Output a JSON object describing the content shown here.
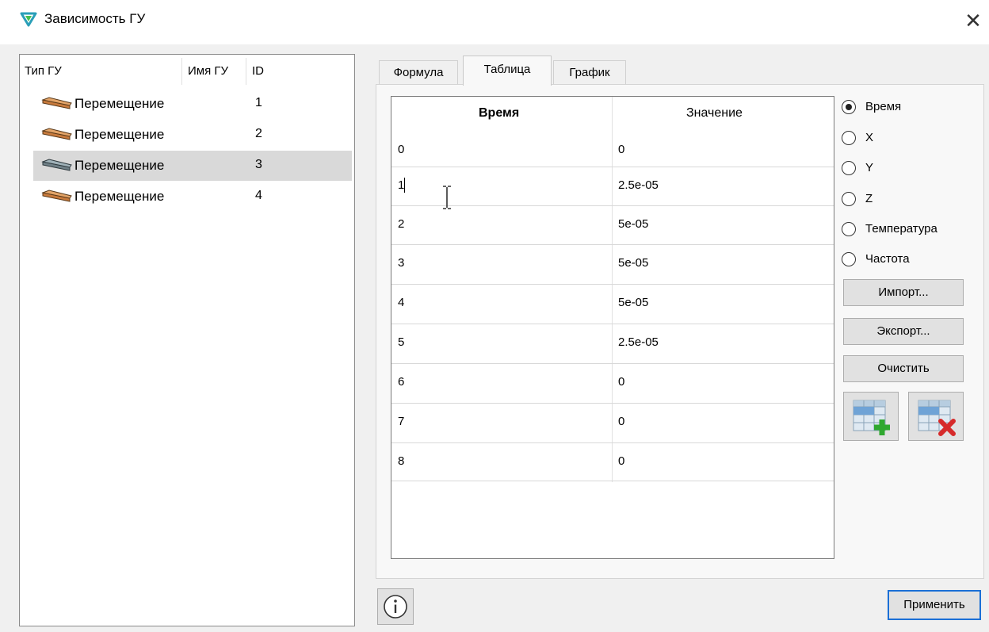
{
  "window": {
    "title": "Зависимость ГУ",
    "close_glyph": "✕"
  },
  "bc_list": {
    "headers": {
      "type": "Тип ГУ",
      "name": "Имя ГУ",
      "id": "ID"
    },
    "rows": [
      {
        "type": "Перемещение",
        "name": "",
        "id": "1",
        "selected": false,
        "icon": "displacement-icon"
      },
      {
        "type": "Перемещение",
        "name": "",
        "id": "2",
        "selected": false,
        "icon": "displacement-icon"
      },
      {
        "type": "Перемещение",
        "name": "",
        "id": "3",
        "selected": true,
        "icon": "displacement-icon"
      },
      {
        "type": "Перемещение",
        "name": "",
        "id": "4",
        "selected": false,
        "icon": "displacement-icon"
      }
    ]
  },
  "tabs": [
    {
      "label": "Формула",
      "active": false
    },
    {
      "label": "Таблица",
      "active": true
    },
    {
      "label": "График",
      "active": false
    }
  ],
  "table": {
    "headers": {
      "time": "Время",
      "value": "Значение"
    },
    "rows": [
      {
        "time": "0",
        "value": "0"
      },
      {
        "time": "1",
        "value": "2.5e-05"
      },
      {
        "time": "2",
        "value": "5e-05"
      },
      {
        "time": "3",
        "value": "5e-05"
      },
      {
        "time": "4",
        "value": "5e-05"
      },
      {
        "time": "5",
        "value": "2.5e-05"
      },
      {
        "time": "6",
        "value": "0"
      },
      {
        "time": "7",
        "value": "0"
      },
      {
        "time": "8",
        "value": "0"
      }
    ],
    "editing_row": 1
  },
  "variable_options": [
    {
      "label": "Время",
      "checked": true
    },
    {
      "label": "X",
      "checked": false
    },
    {
      "label": "Y",
      "checked": false
    },
    {
      "label": "Z",
      "checked": false
    },
    {
      "label": "Температура",
      "checked": false
    },
    {
      "label": "Частота",
      "checked": false
    }
  ],
  "buttons": {
    "import": "Импорт...",
    "export": "Экспорт...",
    "clear": "Очистить",
    "add_row_icon": "add-row-icon",
    "delete_row_icon": "delete-row-icon",
    "info_icon": "info-icon",
    "apply": "Применить"
  },
  "colors": {
    "selection": "#d9d9d9",
    "accent_border": "#1a6fd6",
    "icon_orange": "#c87a3c",
    "icon_gray": "#6f7f86",
    "add_green": "#2fa82f",
    "delete_red": "#d62a2a"
  }
}
